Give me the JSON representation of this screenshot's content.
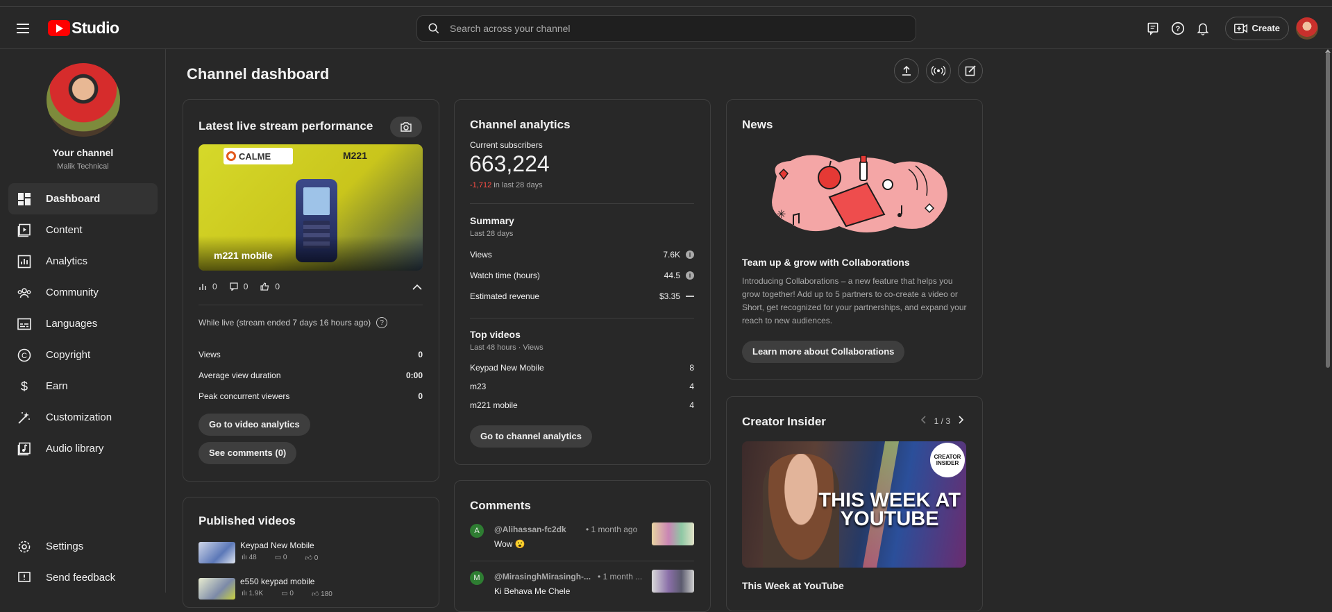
{
  "header": {
    "logo_text": "Studio",
    "search_placeholder": "Search across your channel",
    "create_label": "Create"
  },
  "sidebar": {
    "your_channel": "Your channel",
    "channel_name": "Malik Technical",
    "items": [
      {
        "label": "Dashboard",
        "icon": "dashboard-icon"
      },
      {
        "label": "Content",
        "icon": "content-icon"
      },
      {
        "label": "Analytics",
        "icon": "analytics-icon"
      },
      {
        "label": "Community",
        "icon": "community-icon"
      },
      {
        "label": "Languages",
        "icon": "languages-icon"
      },
      {
        "label": "Copyright",
        "icon": "copyright-icon"
      },
      {
        "label": "Earn",
        "icon": "earn-icon"
      },
      {
        "label": "Customization",
        "icon": "customization-icon"
      },
      {
        "label": "Audio library",
        "icon": "audio-library-icon"
      }
    ],
    "bottom_items": [
      {
        "label": "Settings",
        "icon": "gear-icon"
      },
      {
        "label": "Send feedback",
        "icon": "feedback-icon"
      }
    ]
  },
  "main": {
    "title": "Channel dashboard"
  },
  "live": {
    "title": "Latest live stream performance",
    "thumb_title": "m221 mobile",
    "thumb_brand": "CALME",
    "thumb_model": "M221",
    "views_count": "0",
    "comments_count": "0",
    "likes_count": "0",
    "status": "While live (stream ended 7 days 16 hours ago)",
    "stats": [
      {
        "label": "Views",
        "value": "0"
      },
      {
        "label": "Average view duration",
        "value": "0:00"
      },
      {
        "label": "Peak concurrent viewers",
        "value": "0"
      }
    ],
    "btn_analytics": "Go to video analytics",
    "btn_comments": "See comments (0)"
  },
  "published": {
    "title": "Published videos",
    "videos": [
      {
        "title": "Keypad New Mobile",
        "views": "48",
        "comments": "0",
        "likes": "0"
      },
      {
        "title": "e550 keypad mobile",
        "views": "1.9K",
        "comments": "0",
        "likes": "180"
      }
    ]
  },
  "analytics": {
    "title": "Channel analytics",
    "subs_label": "Current subscribers",
    "subs_value": "663,224",
    "subs_change": "-1,712",
    "subs_change_suffix": "in last 28 days",
    "summary_title": "Summary",
    "summary_period": "Last 28 days",
    "summary_rows": [
      {
        "label": "Views",
        "value": "7.6K"
      },
      {
        "label": "Watch time (hours)",
        "value": "44.5"
      },
      {
        "label": "Estimated revenue",
        "value": "$3.35"
      }
    ],
    "top_title": "Top videos",
    "top_period": "Last 48 hours · Views",
    "top_rows": [
      {
        "label": "Keypad New Mobile",
        "value": "8"
      },
      {
        "label": "m23",
        "value": "4"
      },
      {
        "label": "m221 mobile",
        "value": "4"
      }
    ],
    "btn": "Go to channel analytics"
  },
  "comments": {
    "title": "Comments",
    "items": [
      {
        "initial": "A",
        "author": "@Alihassan-fc2dk",
        "time": "• 1 month ago",
        "text": "Wow 😮",
        "color": "#2e7d32"
      },
      {
        "initial": "M",
        "author": "@MirasinghMirasingh-...",
        "time": "• 1 month ...",
        "text": "Ki Behava Me Chele",
        "color": "#2e7d32"
      }
    ]
  },
  "news": {
    "title": "News",
    "headline": "Team up & grow with Collaborations",
    "body": "Introducing Collaborations – a new feature that helps you grow together! Add up to 5 partners to co-create a video or Short, get recognized for your partnerships, and expand your reach to new audiences.",
    "btn": "Learn more about Collaborations"
  },
  "insider": {
    "title": "Creator Insider",
    "pager": "1 / 3",
    "badge_line1": "CREATOR",
    "badge_line2": "INSIDER",
    "thumb_line1": "THIS WEEK AT",
    "thumb_line2": "YOUTUBE",
    "video_title": "This Week at YouTube"
  },
  "colors": {
    "background": "#282828",
    "border": "#3e3e3e",
    "accent_red": "#ff0000",
    "negative": "#ff4e45"
  }
}
